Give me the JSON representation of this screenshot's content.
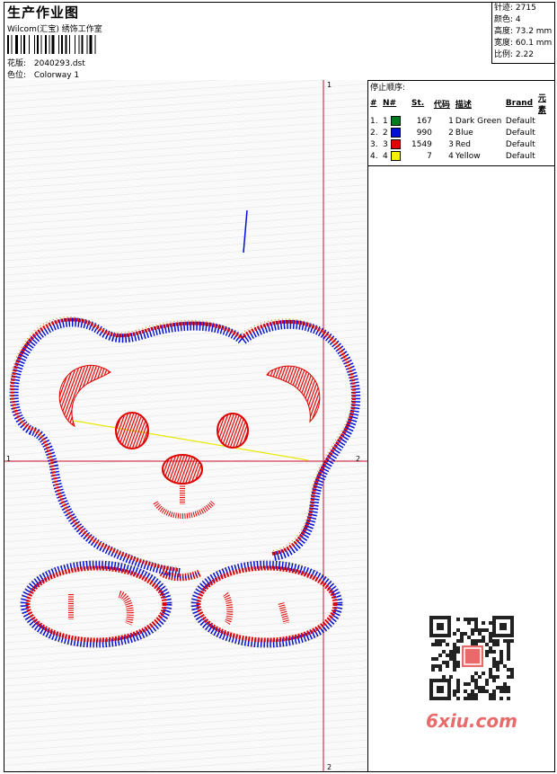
{
  "header": {
    "title": "生产作业图",
    "company": "Wilcom(汇宝) 绣饰工作室",
    "design_label": "花版:",
    "design_value": "2040293.dst",
    "colorway_label": "色位:",
    "colorway_value": "Colorway 1"
  },
  "stats": {
    "stitches": "针迹: 2715",
    "colors": "颜色: 4",
    "height": "高度: 73.2 mm",
    "width": "宽度: 60.1 mm",
    "scale": "比例: 2.22"
  },
  "stop_sequence": {
    "title": "停止顺序:",
    "headers": [
      "#",
      "N#",
      "St.",
      "代码",
      "描述",
      "Brand",
      "元素"
    ],
    "rows": [
      {
        "num": "1.",
        "n": "1",
        "color": "#007a1f",
        "st": "167",
        "code": "1",
        "desc": "Dark Green",
        "brand": "Default"
      },
      {
        "num": "2.",
        "n": "2",
        "color": "#0010d8",
        "st": "990",
        "code": "2",
        "desc": "Blue",
        "brand": "Default"
      },
      {
        "num": "3.",
        "n": "3",
        "color": "#e00000",
        "st": "1549",
        "code": "3",
        "desc": "Red",
        "brand": "Default"
      },
      {
        "num": "4.",
        "n": "4",
        "color": "#f2f200",
        "st": "7",
        "code": "4",
        "desc": "Yellow",
        "brand": "Default"
      }
    ]
  },
  "axes": {
    "top": "1",
    "left": "1",
    "right": "2",
    "bottom": "2"
  },
  "watermark": {
    "site": "6xiu.com"
  },
  "colors": {
    "red": "#e00000",
    "blue": "#0010d8",
    "gold": "#b28a00",
    "yellow": "#e8e800",
    "guide": "#c8102e"
  }
}
